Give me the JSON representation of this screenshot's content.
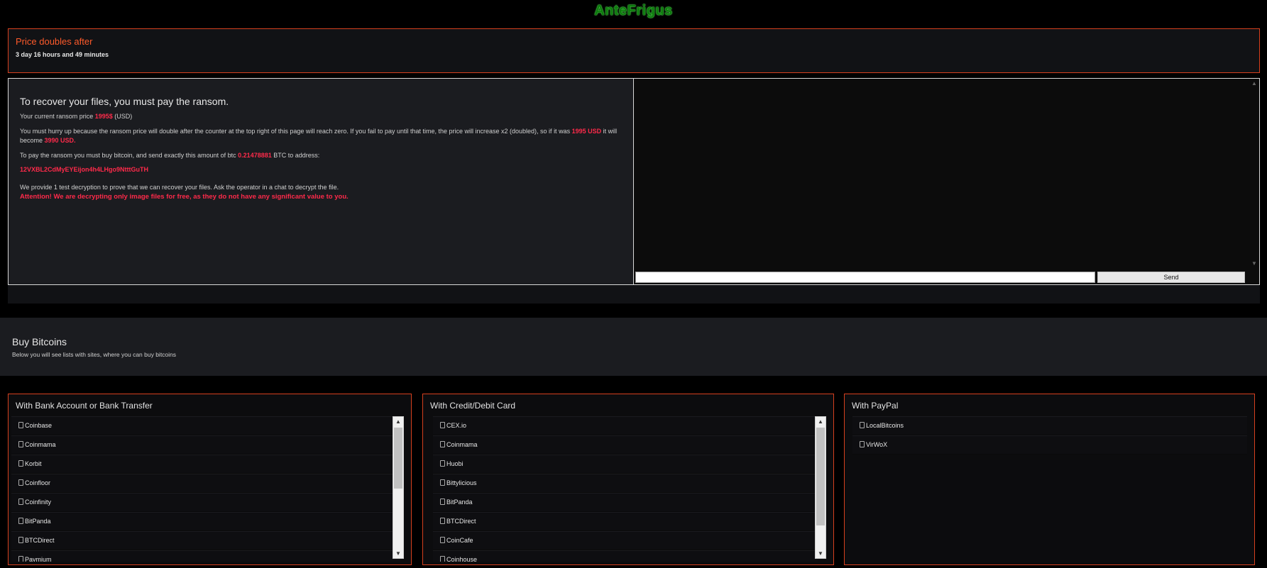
{
  "app": {
    "title": "AnteFrigus"
  },
  "timer": {
    "heading": "Price doubles after",
    "value": "3 day 16 hours and 49 minutes"
  },
  "ransom": {
    "heading": "To recover your files, you must pay the ransom.",
    "current_price_prefix": "Your current ransom price ",
    "current_price": "1995$",
    "current_price_suffix": " (USD)",
    "hurry_part1": "You must hurry up because the ransom price will double after the counter at the top right of this page will reach zero. If you fail to pay until that time, the price will increase x2 (doubled), so if it was ",
    "hurry_price": "1995 USD",
    "hurry_part2": " it will become ",
    "hurry_new_price": "3990 USD",
    "hurry_end": ".",
    "btc_prefix": "To pay the ransom you must buy bitcoin, and send exactly this amount of btc ",
    "btc_amount": "0.21478881",
    "btc_suffix": " BTC to address:",
    "address": "12VXBL2CdMyEYEijon4h4LHgo9NtttGuTH",
    "test_decrypt": "We provide 1 test decryption to prove that we can recover your files. Ask the operator in a chat to decrypt the file.",
    "attention": "Attention! We are decrypting only image files for free, as they do not have any significant value to you."
  },
  "chat": {
    "input_value": "",
    "send_label": "Send"
  },
  "buy": {
    "heading": "Buy Bitcoins",
    "subtitle": "Below you will see lists with sites, where you can buy bitcoins"
  },
  "columns": {
    "bank": {
      "title": "With Bank Account or Bank Transfer",
      "items": [
        "Coinbase",
        "Coinmama",
        "Korbit",
        "Coinfloor",
        "Coinfinity",
        "BitPanda",
        "BTCDirect",
        "Paymium"
      ]
    },
    "card": {
      "title": "With Credit/Debit Card",
      "items": [
        "CEX.io",
        "Coinmama",
        "Huobi",
        "Bittylicious",
        "BitPanda",
        "BTCDirect",
        "CoinCafe",
        "Coinhouse"
      ]
    },
    "paypal": {
      "title": "With PayPal",
      "items": [
        "LocalBitcoins",
        "VirWoX"
      ]
    }
  },
  "icons": {
    "list_item_icon": "link-icon",
    "scroll_up_icon": "chevron-up-icon",
    "scroll_down_icon": "chevron-down-icon"
  },
  "colors": {
    "title_green": "#0d7a0d",
    "accent_orange": "#d6401e",
    "highlight_red": "#ff2a4a"
  }
}
